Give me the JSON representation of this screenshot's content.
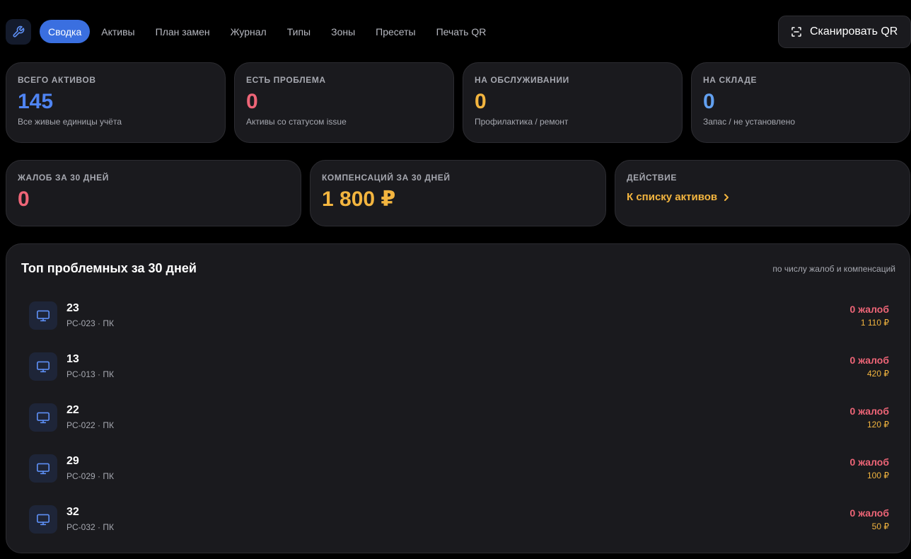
{
  "nav": {
    "items": [
      {
        "label": "Сводка",
        "active": true
      },
      {
        "label": "Активы"
      },
      {
        "label": "План замен"
      },
      {
        "label": "Журнал"
      },
      {
        "label": "Типы"
      },
      {
        "label": "Зоны"
      },
      {
        "label": "Пресеты"
      },
      {
        "label": "Печать QR"
      }
    ],
    "scan_label": "Сканировать QR"
  },
  "stats": [
    {
      "label": "ВСЕГО АКТИВОВ",
      "value": "145",
      "sub": "Все живые единицы учёта",
      "color": "#4f84f2"
    },
    {
      "label": "ЕСТЬ ПРОБЛЕМА",
      "value": "0",
      "sub": "Активы со статусом issue",
      "color": "#ee6577"
    },
    {
      "label": "НА ОБСЛУЖИВАНИИ",
      "value": "0",
      "sub": "Профилактика / ремонт",
      "color": "#f3b53f"
    },
    {
      "label": "НА СКЛАДЕ",
      "value": "0",
      "sub": "Запас / не установлено",
      "color": "#62a0f0"
    }
  ],
  "stats2": [
    {
      "label": "ЖАЛОБ ЗА 30 ДНЕЙ",
      "value": "0",
      "color": "#ee6577"
    },
    {
      "label": "КОМПЕНСАЦИЙ ЗА 30 ДНЕЙ",
      "value": "1 800 ₽",
      "color": "#f3b53f"
    }
  ],
  "action": {
    "label": "ДЕЙСТВИЕ",
    "link": "К списку активов"
  },
  "top": {
    "title": "Топ проблемных за 30 дней",
    "note": "по числу жалоб и компенсаций",
    "rows": [
      {
        "name": "23",
        "sub": "PC-023 · ПК",
        "complaints": "0 жалоб",
        "compensation": "1 110 ₽"
      },
      {
        "name": "13",
        "sub": "PC-013 · ПК",
        "complaints": "0 жалоб",
        "compensation": "420 ₽"
      },
      {
        "name": "22",
        "sub": "PC-022 · ПК",
        "complaints": "0 жалоб",
        "compensation": "120 ₽"
      },
      {
        "name": "29",
        "sub": "PC-029 · ПК",
        "complaints": "0 жалоб",
        "compensation": "100 ₽"
      },
      {
        "name": "32",
        "sub": "PC-032 · ПК",
        "complaints": "0 жалоб",
        "compensation": "50 ₽"
      }
    ]
  },
  "icons": {
    "app": "wrench-icon",
    "scan": "scan-frame-icon",
    "row": "monitor-icon",
    "link": "chevron-right-icon"
  },
  "colors": {
    "accent": "#3a6fe0",
    "background": "#000000",
    "card": "#1a1a1e",
    "red": "#ee6577",
    "yellow": "#f3b53f",
    "blue": "#4f84f2"
  }
}
